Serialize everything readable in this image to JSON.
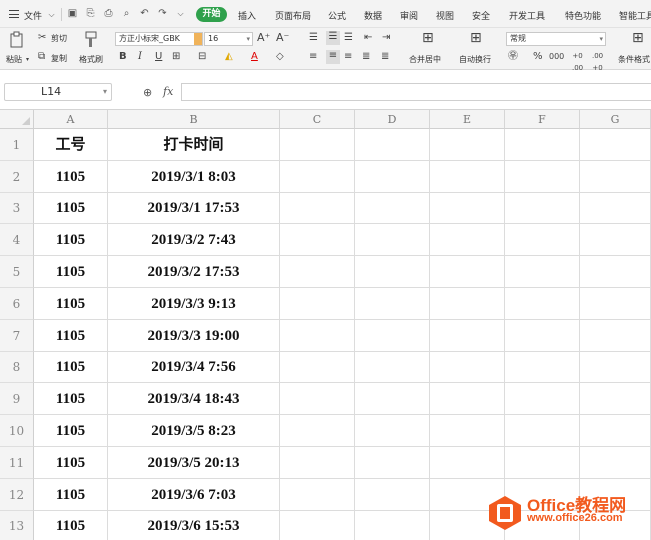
{
  "menubar": {
    "file": "文件",
    "tabs": [
      "开始",
      "插入",
      "页面布局",
      "公式",
      "数据",
      "审阅",
      "视图",
      "安全",
      "开发工具",
      "特色功能",
      "智能工具"
    ]
  },
  "ribbon": {
    "paste": "粘贴",
    "cut": "剪切",
    "copy": "复制",
    "format_painter": "格式刷",
    "font_name": "方正小标宋_GBK",
    "font_size": "16",
    "merge_center": "合并居中",
    "wrap_text": "自动换行",
    "number_format": "常规",
    "conditional_format": "条件格式"
  },
  "formula_bar": {
    "name_box": "L14",
    "fx": "fx",
    "value": ""
  },
  "sheet": {
    "columns": [
      "A",
      "B",
      "C",
      "D",
      "E",
      "F",
      "G"
    ],
    "row_numbers": [
      "1",
      "2",
      "3",
      "4",
      "5",
      "6",
      "7",
      "8",
      "9",
      "10",
      "11",
      "12",
      "13"
    ],
    "rows": [
      [
        "工号",
        "打卡时间"
      ],
      [
        "1105",
        "2019/3/1 8:03"
      ],
      [
        "1105",
        "2019/3/1 17:53"
      ],
      [
        "1105",
        "2019/3/2 7:43"
      ],
      [
        "1105",
        "2019/3/2 17:53"
      ],
      [
        "1105",
        "2019/3/3 9:13"
      ],
      [
        "1105",
        "2019/3/3 19:00"
      ],
      [
        "1105",
        "2019/3/4 7:56"
      ],
      [
        "1105",
        "2019/3/4 18:43"
      ],
      [
        "1105",
        "2019/3/5 8:23"
      ],
      [
        "1105",
        "2019/3/5 20:13"
      ],
      [
        "1105",
        "2019/3/6 7:03"
      ],
      [
        "1105",
        "2019/3/6 15:53"
      ]
    ]
  },
  "watermark": {
    "title": "Office教程网",
    "url": "www.office26.com",
    "color": "#f25a1e"
  },
  "colors": {
    "active_tab": "#2fa14c",
    "header_bg": "#f4f4f4",
    "gridline": "#dcdcdc"
  }
}
